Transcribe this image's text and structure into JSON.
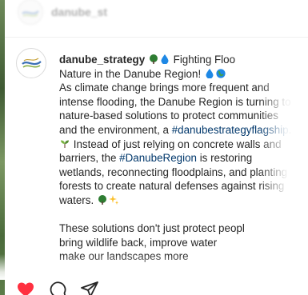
{
  "header": {
    "username": "danube_st",
    "avatar_icon": "danube-logo-icon"
  },
  "post": {
    "username": "danube_strategy",
    "title_line_1": "Fighting Floo",
    "title_line_2": "Nature in the Danube Region!",
    "p1_line_1": "As climate change brings more frequent and",
    "p1_line_2": "intense flooding, the Danube Region is turning to",
    "p1_line_3": "nature-based solutions to protect communities",
    "p1_line_4_text": "and the environment, a ",
    "hashtag_flagship": "#danubestrategyflagship",
    "p1_line_4_end": ".",
    "p1_line_5": "Instead of just relying on concrete walls and",
    "p1_line_6_text": "barriers, the ",
    "hashtag_region": "#DanubeRegion",
    "p1_line_6_end": " is restoring",
    "p1_line_7": "wetlands, reconnecting floodplains, and planting",
    "p1_line_8": "forests to create natural defenses against rising",
    "p1_line_9": "waters.",
    "p2_line_1": "These solutions don't just protect peopl",
    "p2_line_2": "bring wildlife back, improve water",
    "p2_line_3": "make our landscapes more"
  },
  "actions": {
    "like_icon": "heart-filled-icon",
    "comment_icon": "comment-icon",
    "share_icon": "send-icon"
  },
  "colors": {
    "text": "#262626",
    "hashtag": "#00376b",
    "like": "#ff3040",
    "tree_green": "#2e7d32",
    "water_blue": "#1e88e5"
  }
}
